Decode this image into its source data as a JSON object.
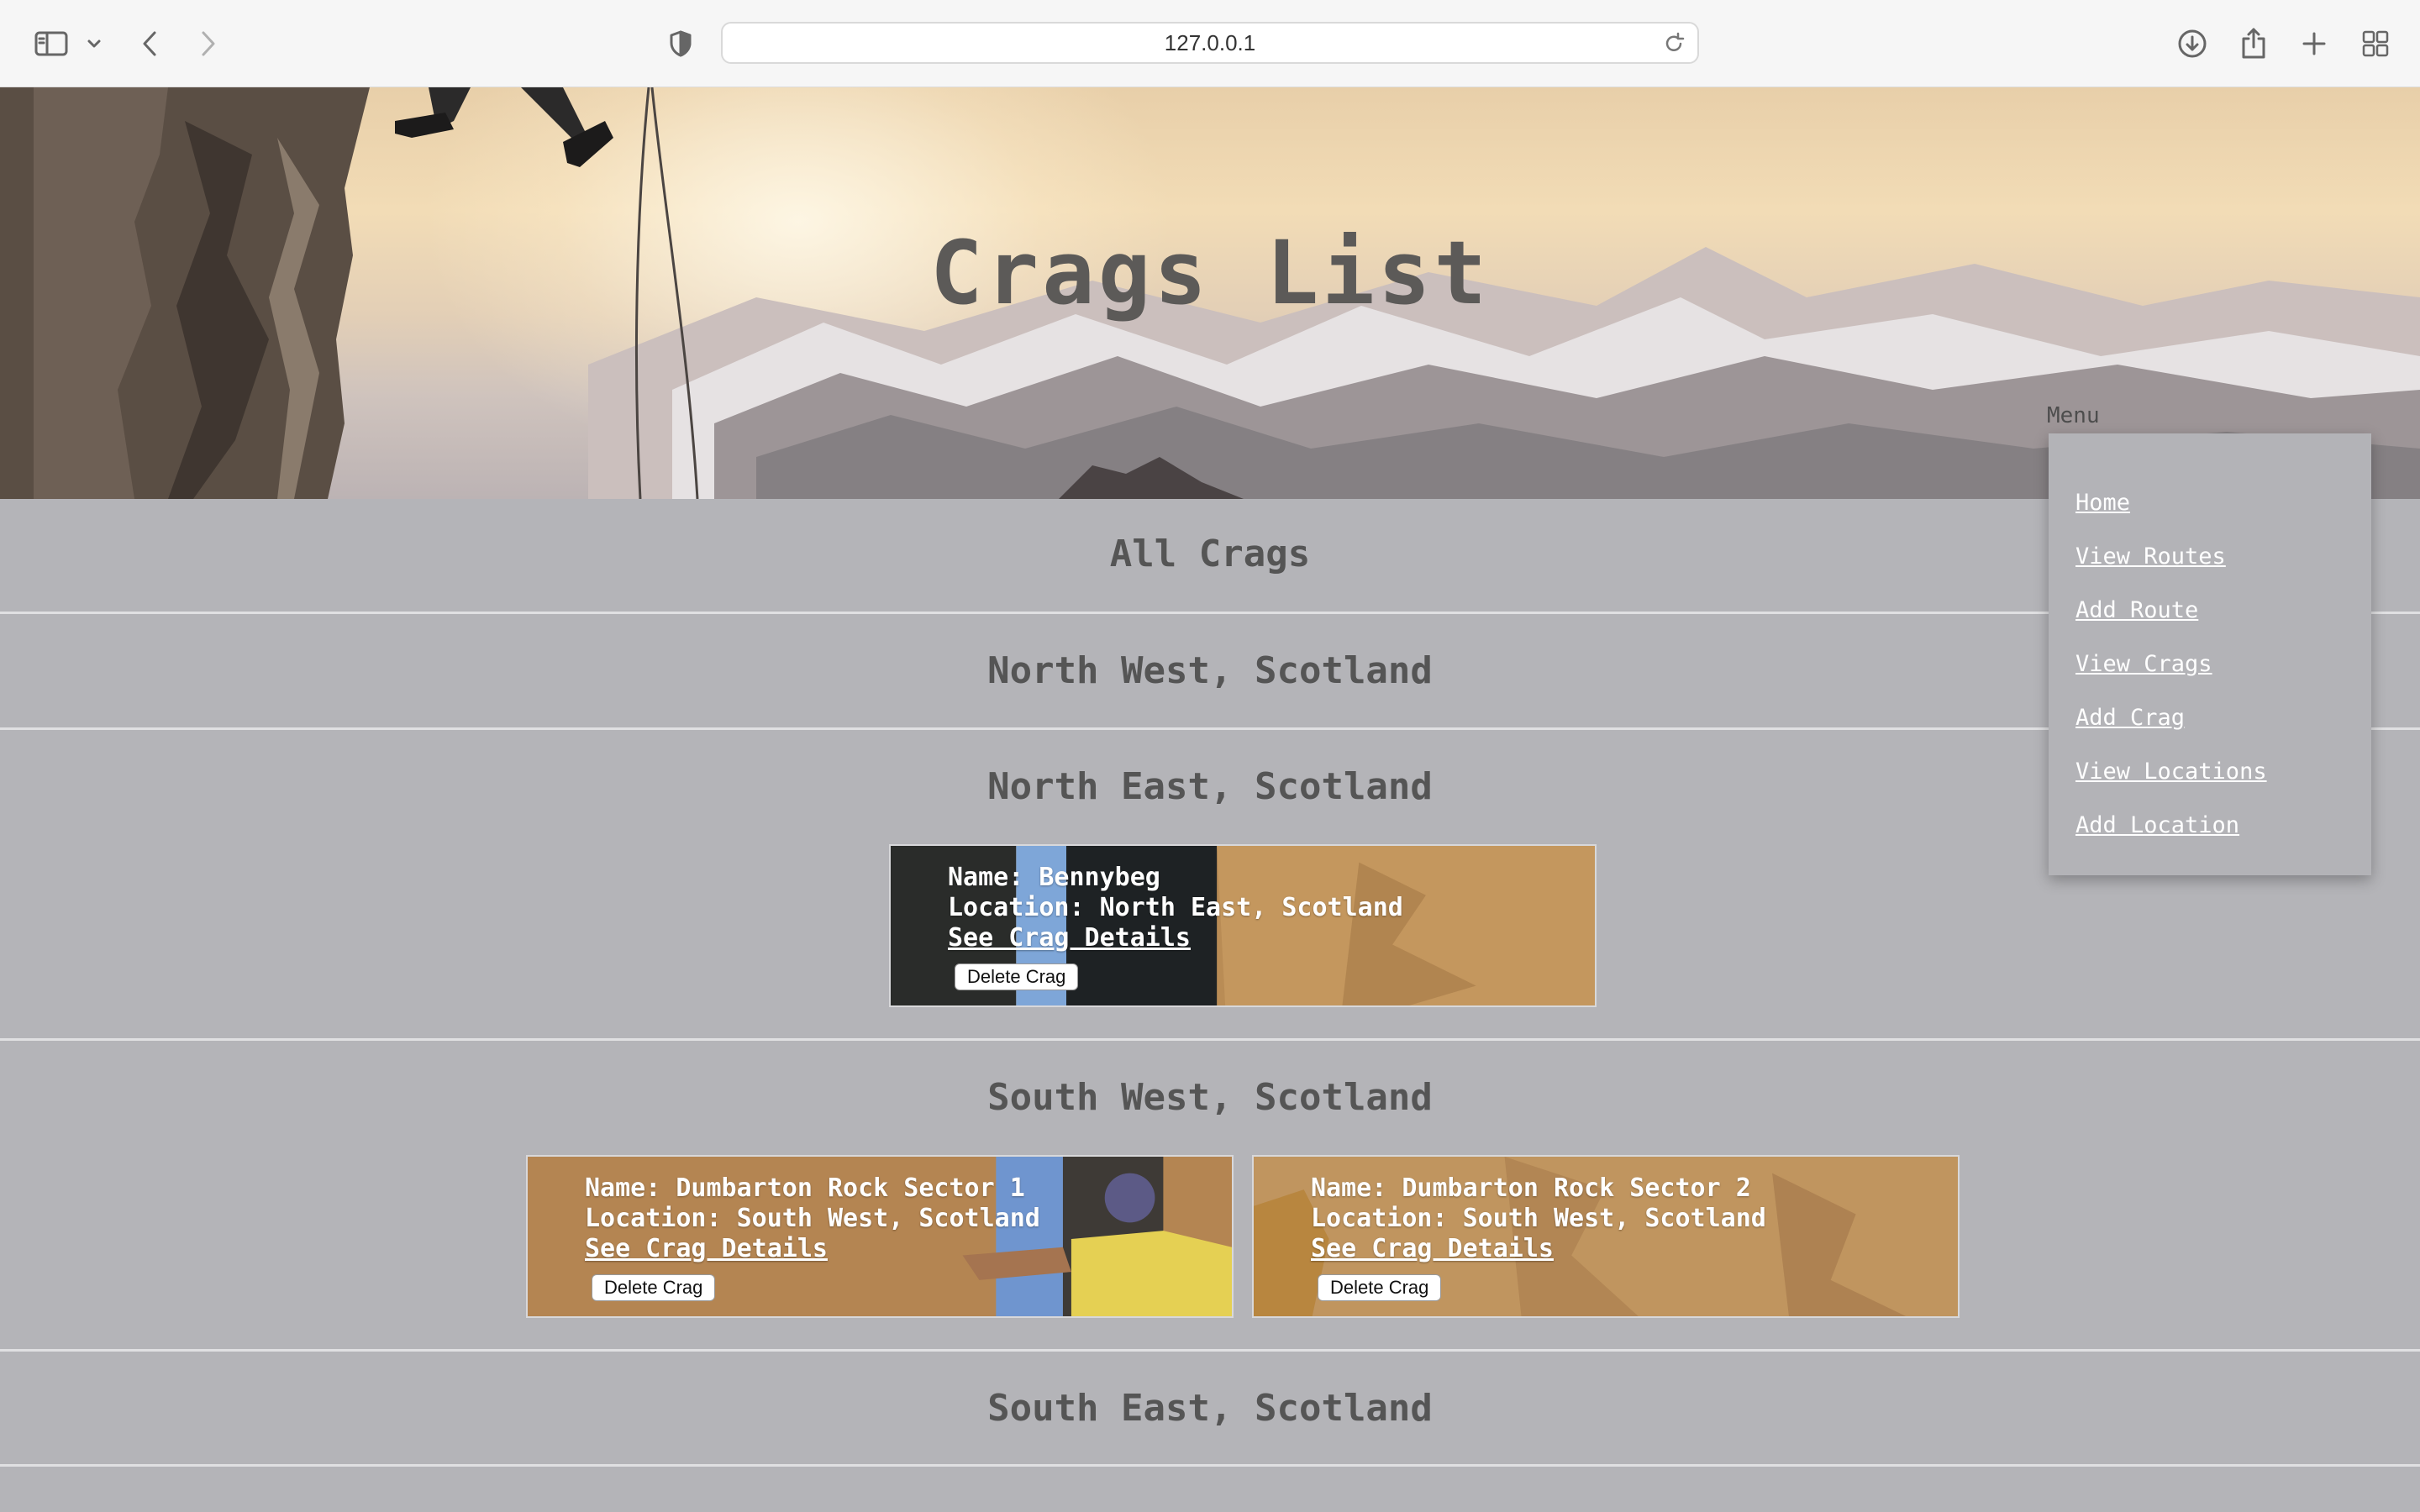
{
  "browser": {
    "url": "127.0.0.1",
    "icons": [
      "sidebar-icon",
      "chevron-down-icon",
      "back-icon",
      "forward-icon",
      "shield-icon",
      "reload-icon",
      "download-icon",
      "share-icon",
      "plus-icon",
      "tabs-grid-icon"
    ]
  },
  "hero": {
    "title": "Crags List"
  },
  "menu": {
    "label": "Menu",
    "items": [
      "Home",
      "View Routes",
      "Add Route",
      "View Crags",
      "Add Crag",
      "View Locations",
      "Add Location"
    ]
  },
  "sections": [
    {
      "heading": "All Crags",
      "crags": []
    },
    {
      "heading": "North West, Scotland",
      "crags": []
    },
    {
      "heading": "North East, Scotland",
      "crags": [
        {
          "name": "Name: Bennybeg",
          "location": "Location: North East, Scotland",
          "details_link": "See Crag Details",
          "delete_label": "Delete Crag"
        }
      ]
    },
    {
      "heading": "South West, Scotland",
      "crags": [
        {
          "name": "Name: Dumbarton Rock Sector 1",
          "location": "Location: South West, Scotland",
          "details_link": "See Crag Details",
          "delete_label": "Delete Crag"
        },
        {
          "name": "Name: Dumbarton Rock Sector 2",
          "location": "Location: South West, Scotland",
          "details_link": "See Crag Details",
          "delete_label": "Delete Crag"
        }
      ]
    },
    {
      "heading": "South East, Scotland",
      "crags": []
    }
  ]
}
